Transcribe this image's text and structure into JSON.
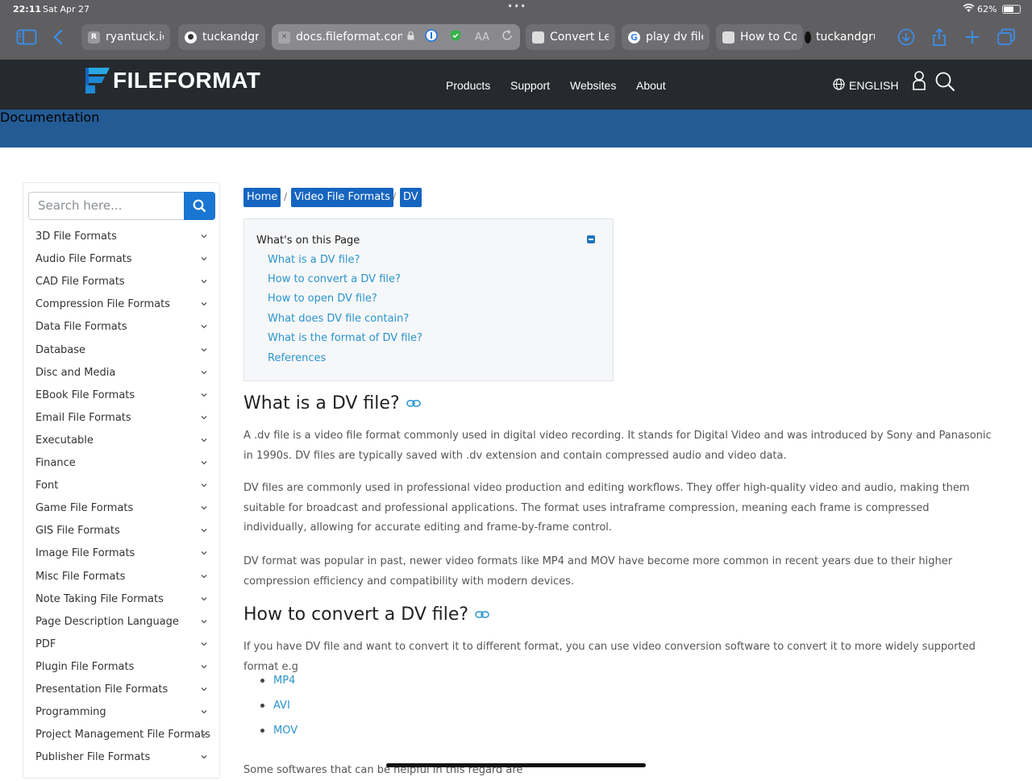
{
  "status_bar": {
    "time": "22:11",
    "date": "Sat Apr 27",
    "battery": "62%",
    "battery_level": 0.62
  },
  "browser": {
    "tabs": [
      {
        "label": "ryantuck.io",
        "icon": "r-favicon"
      },
      {
        "label": "tuckandgrul",
        "icon": "github-icon"
      },
      {
        "label": "docs.fileformat.com",
        "icon": "close-tab-icon",
        "active": true
      },
      {
        "label": "Convert Leg",
        "icon": "apple-favicon"
      },
      {
        "label": "play dv file l",
        "icon": "google-favicon"
      },
      {
        "label": "How to Con",
        "icon": "apple-favicon"
      },
      {
        "label": "tuckandgrul",
        "icon": "github-icon"
      }
    ],
    "reader_label": "AA"
  },
  "site": {
    "logo_text": "FILEFORMAT",
    "nav": [
      "Products",
      "Support",
      "Websites",
      "About"
    ],
    "language": "ENGLISH",
    "section_title": "Documentation"
  },
  "sidebar": {
    "search_placeholder": "Search here...",
    "items": [
      "3D File Formats",
      "Audio File Formats",
      "CAD File Formats",
      "Compression File Formats",
      "Data File Formats",
      "Database",
      "Disc and Media",
      "EBook File Formats",
      "Email File Formats",
      "Executable",
      "Finance",
      "Font",
      "Game File Formats",
      "GIS File Formats",
      "Image File Formats",
      "Misc File Formats",
      "Note Taking File Formats",
      "Page Description Language",
      "PDF",
      "Plugin File Formats",
      "Presentation File Formats",
      "Programming",
      "Project Management File Formats",
      "Publisher File Formats"
    ]
  },
  "breadcrumb": {
    "items": [
      "Home",
      "Video File Formats",
      "DV"
    ],
    "separator": "/"
  },
  "toc": {
    "title": "What's on this Page",
    "links": [
      "What is a DV file?",
      "How to convert a DV file?",
      "How to open DV file?",
      "What does DV file contain?",
      "What is the format of DV file?",
      "References"
    ]
  },
  "article": {
    "h_what": "What is a DV file?",
    "p1": "A .dv file is a video file format commonly used in digital video recording. It stands for Digital Video and was introduced by Sony and Panasonic in 1990s. DV files are typically saved with .dv extension and contain compressed audio and video data.",
    "p2": "DV files are commonly used in professional video production and editing workflows. They offer high-quality video and audio, making them suitable for broadcast and professional applications. The format uses intraframe compression, meaning each frame is compressed individually, allowing for accurate editing and frame-by-frame control.",
    "p3": "DV format was popular in past, newer video formats like MP4 and MOV have become more common in recent years due to their higher compression efficiency and compatibility with modern devices.",
    "h_convert": "How to convert a DV file?",
    "p4": "If you have DV file and want to convert it to different format, you can use video conversion software to convert it to more widely supported format e.g",
    "formats": [
      "MP4",
      "AVI",
      "MOV"
    ],
    "p5": "Some softwares that can be helpful in this regard are"
  },
  "colors": {
    "site_header": "#262a2e",
    "doc_bar": "#245b94",
    "accent": "#1565c0",
    "link": "#2a94cc"
  }
}
